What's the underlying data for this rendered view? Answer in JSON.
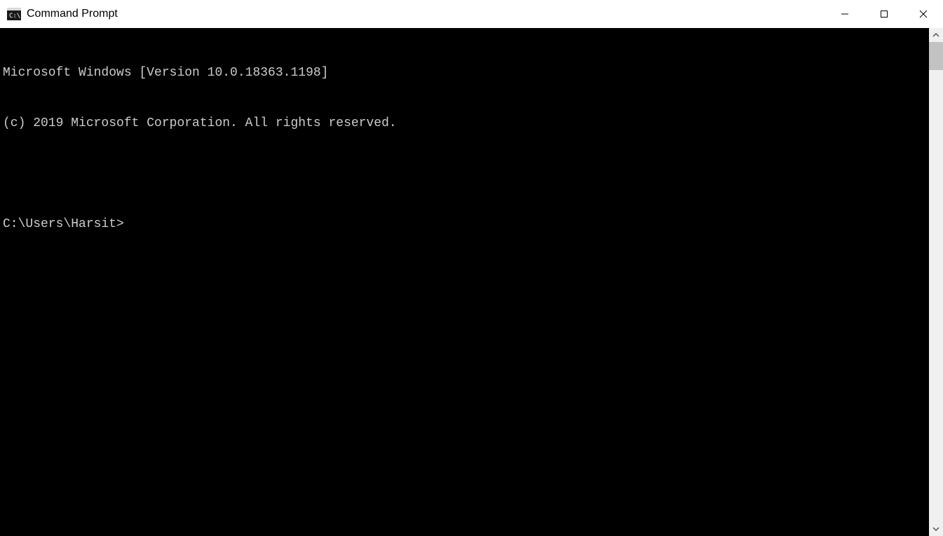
{
  "window": {
    "title": "Command Prompt"
  },
  "terminal": {
    "version_line": "Microsoft Windows [Version 10.0.18363.1198]",
    "copyright_line": "(c) 2019 Microsoft Corporation. All rights reserved.",
    "prompt": "C:\\Users\\Harsit>"
  }
}
